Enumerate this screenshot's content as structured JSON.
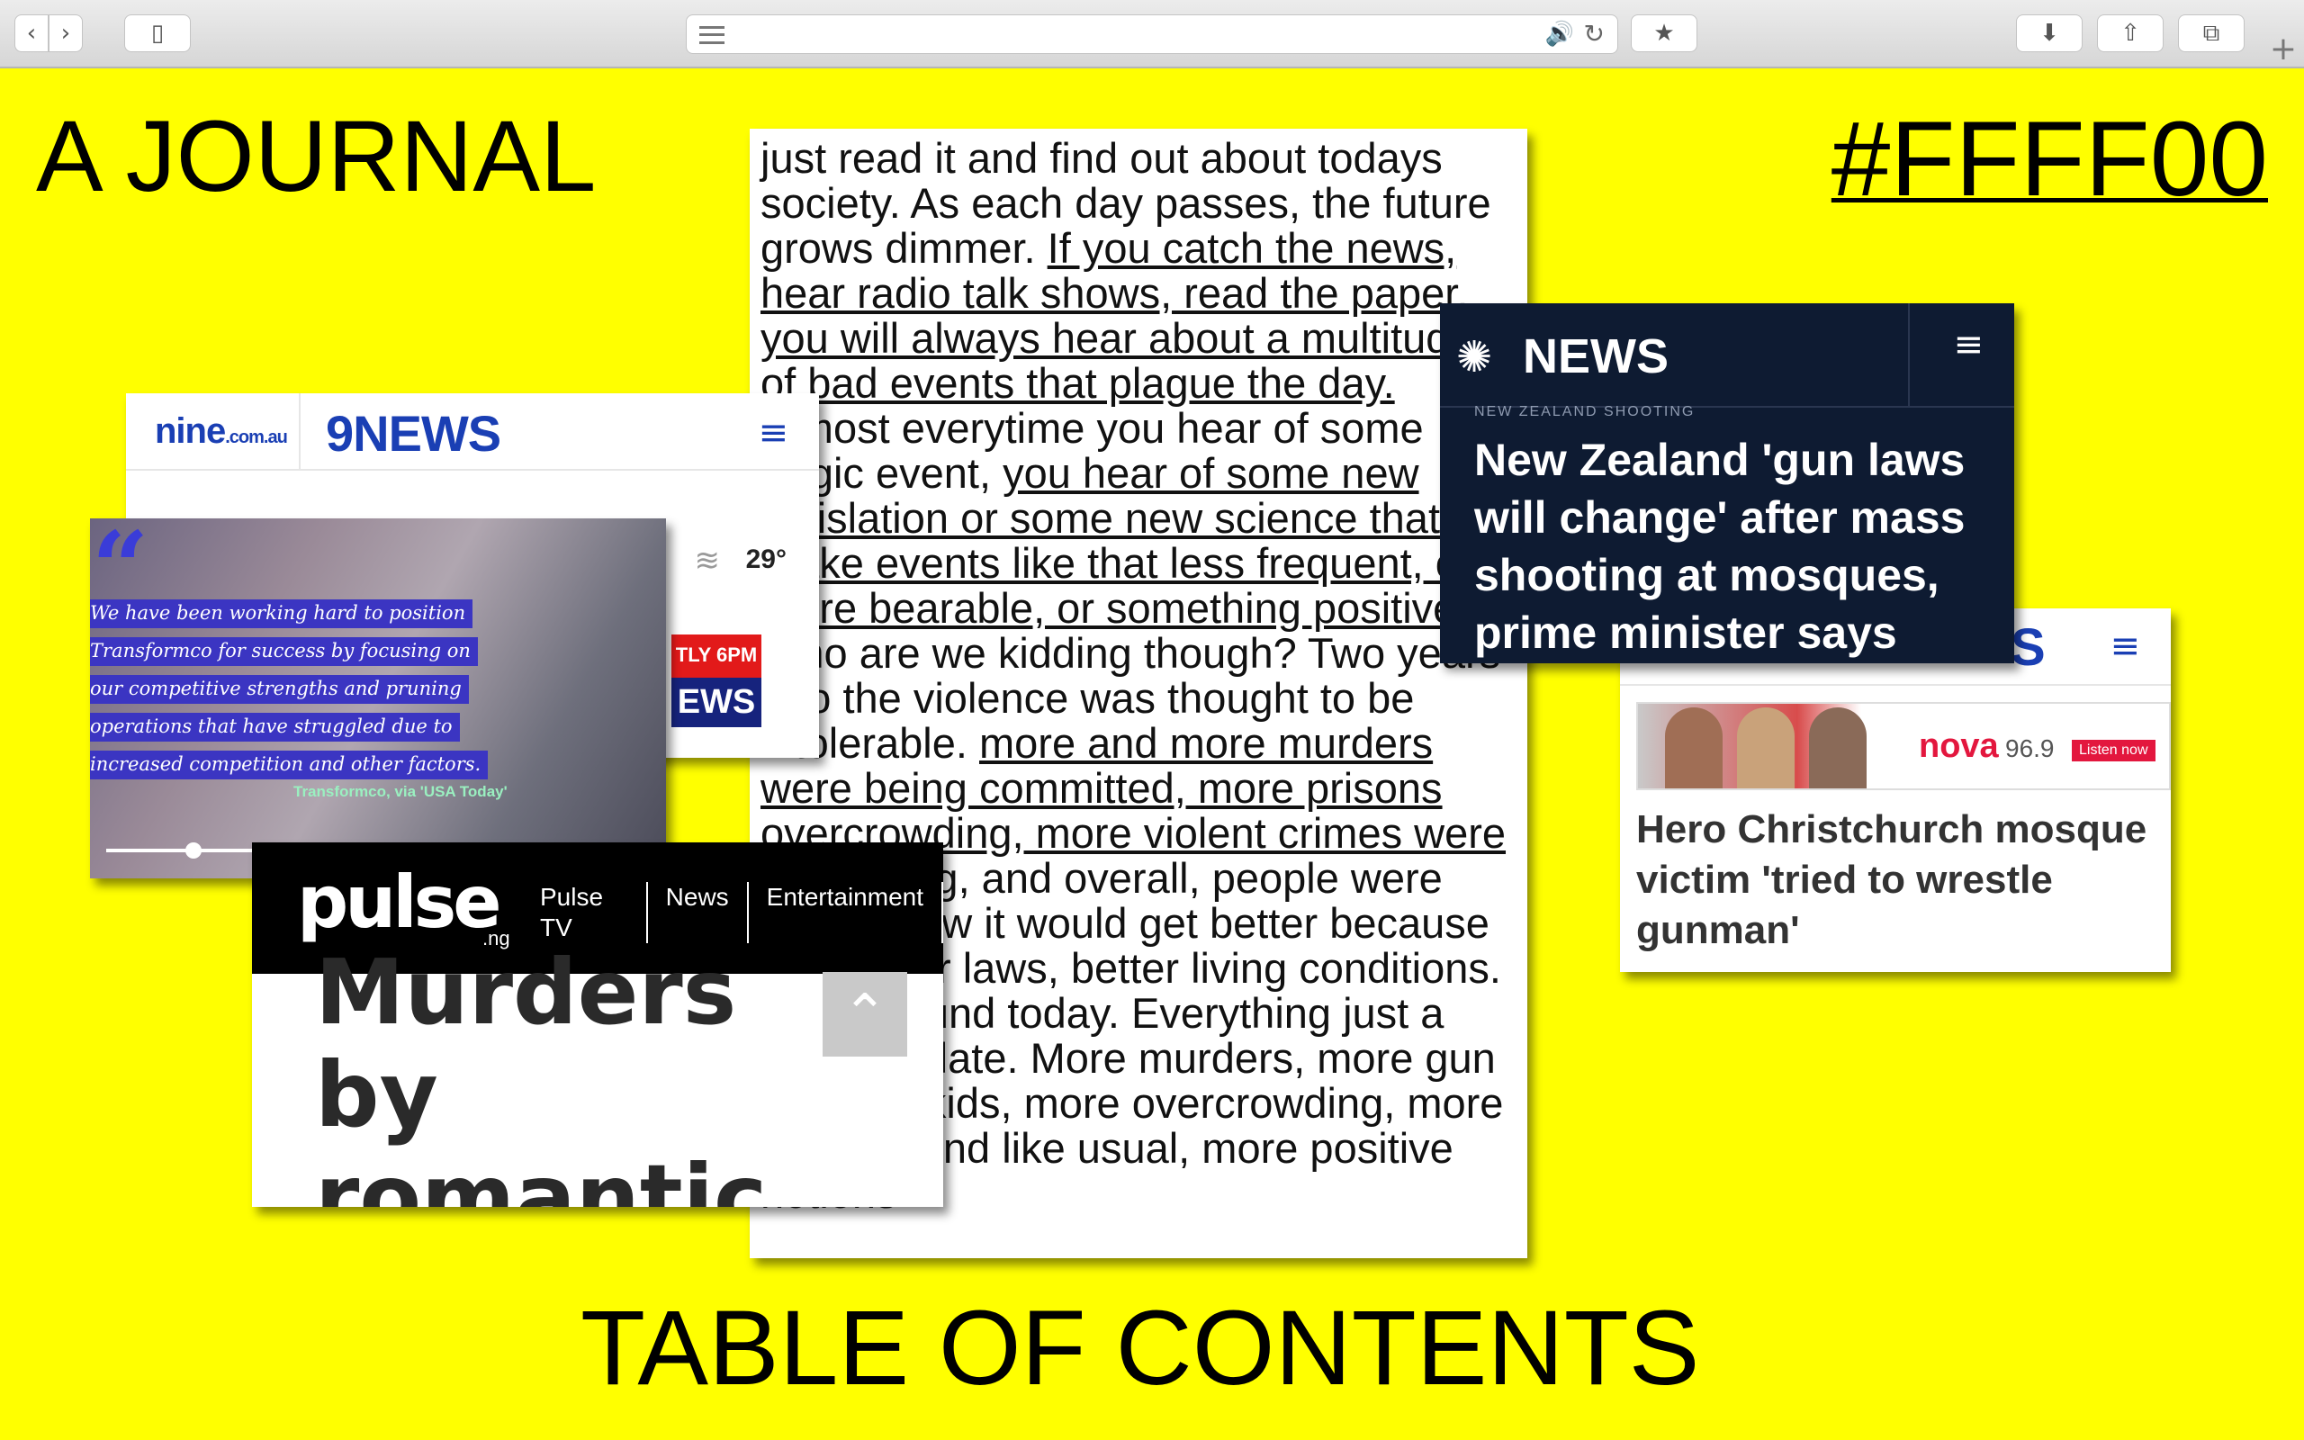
{
  "browser": {
    "back_icon": "chevron-left-icon",
    "forward_icon": "chevron-right-icon",
    "sidebar_icon": "sidebar-icon",
    "reader_icon": "reader-icon",
    "audio_icon": "speaker-icon",
    "reload_icon": "reload-icon",
    "bookmark_icon": "star-icon",
    "download_icon": "download-icon",
    "share_icon": "share-icon",
    "tabs_icon": "tabs-icon",
    "new_tab_icon": "plus-icon"
  },
  "page": {
    "title": "A JOURNAL",
    "color_code": "#FFFF00",
    "toc": "TABLE OF CONTENTS",
    "background": "#FFFF00"
  },
  "essay": {
    "seg1": "just read it and find out about todays society. As each day passes, the future grows dimmer. ",
    "link1": "If you catch the news, hear radio talk shows, read the paper, you will always hear about a multitude of bad events that plague the day.",
    "seg2": " Almost everytime you hear of some tragic event, ",
    "link2": "you hear of some new legislation or some new science that will make events like that less frequent, or more bearable, or something positive.",
    "seg3": " Who are we kidding though? Two years ago the violence was thought to be intolerable. ",
    "link3": "more and more murders were being committed, more prisons overcrowding, more violent crimes were happening",
    "seg4": ", and overall, people were saying how it would get better because of tougher laws, better living conditions. Look around today. Everything just a different date. More murders, more gun wielding kids, more overcrowding, more poverty, and like usual, more positive notions"
  },
  "nine": {
    "logo_small": "nine",
    "logo_small_sub": ".com.au",
    "logo_main": "9NEWS",
    "menu_icon": "hamburger-icon",
    "weather_icon": "wind-icon",
    "temperature": "29°",
    "promo_top": "TLY 6PM",
    "promo_bottom": "EWS"
  },
  "video": {
    "lines": [
      "We have been working hard to position",
      "Transformco for success by focusing on",
      "our competitive strengths and pruning",
      "operations that have struggled due to",
      "increased competition and other factors."
    ],
    "source": "Transformco, via 'USA Today'",
    "progress": 0.4
  },
  "pulse": {
    "logo": "pulse",
    "logo_sub": ".ng",
    "nav": [
      "Pulse TV",
      "News",
      "Entertainment"
    ],
    "headline": "Murders by romantic partners are",
    "scroll_icon": "chevron-up-icon"
  },
  "nbc": {
    "logo": "NEWS",
    "logo_icon": "peacock-icon",
    "menu_icon": "hamburger-icon",
    "kicker": "NEW ZEALAND SHOOTING",
    "headline": "New Zealand 'gun laws will change' after mass shooting at mosques, prime minister says"
  },
  "nova": {
    "logo_fragment": "S",
    "menu_icon": "hamburger-icon",
    "ad_brand": "nova",
    "ad_freq": "96.9",
    "ad_cta": "Listen now",
    "headline": "Hero Christchurch mosque victim 'tried to wrestle gunman'"
  }
}
